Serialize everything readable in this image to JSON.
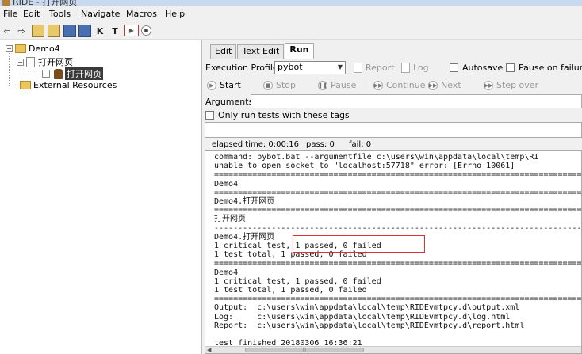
{
  "window": {
    "title": "RIDE - 打开网页"
  },
  "menu": [
    "File",
    "Edit",
    "Tools",
    "Navigate",
    "Macros",
    "Help"
  ],
  "toolbar": {
    "icons": [
      "back-arrow-icon",
      "forward-arrow-icon",
      "open-folder-icon",
      "open-directory-icon",
      "save-icon",
      "save-all-icon",
      "keyword-search-icon",
      "test-search-icon",
      "run-icon",
      "stop-icon"
    ],
    "k_label": "K",
    "t_label": "T"
  },
  "tree": {
    "root": "Demo4",
    "suite": "打开网页",
    "test": "打开网页",
    "external": "External Resources"
  },
  "tabs": [
    "Edit",
    "Text Edit",
    "Run"
  ],
  "active_tab": "Run",
  "run": {
    "profile_label": "Execution Profile:",
    "profile_value": "pybot",
    "report_label": "Report",
    "log_label": "Log",
    "autosave_label": "Autosave",
    "pause_label": "Pause on failure",
    "start_label": "Start",
    "stop_label": "Stop",
    "pausebtn_label": "Pause",
    "continue_label": "Continue",
    "next_label": "Next",
    "stepover_label": "Step over",
    "arguments_label": "Arguments:",
    "only_tags_label": "Only run tests with these tags"
  },
  "status": {
    "elapsed": "elapsed time: 0:00:16",
    "pass": "pass: 0",
    "fail": "fail: 0"
  },
  "output_lines": [
    "command: pybot.bat --argumentfile c:\\users\\win\\appdata\\local\\temp\\RI",
    "unable to open socket to \"localhost:57718\" error: [Errno 10061]",
    "==============================================================================",
    "Demo4",
    "==============================================================================",
    "Demo4.打开网页",
    "==============================================================================",
    "打开网页",
    "------------------------------------------------------------------------------",
    "Demo4.打开网页",
    "1 critical test, 1 passed, 0 failed",
    "1 test total, 1 passed, 0 failed",
    "==============================================================================",
    "Demo4",
    "1 critical test, 1 passed, 0 failed",
    "1 test total, 1 passed, 0 failed",
    "==============================================================================",
    "Output:  c:\\users\\win\\appdata\\local\\temp\\RIDEvmtpcy.d\\output.xml",
    "Log:     c:\\users\\win\\appdata\\local\\temp\\RIDEvmtpcy.d\\log.html",
    "Report:  c:\\users\\win\\appdata\\local\\temp\\RIDEvmtpcy.d\\report.html",
    "",
    "test finished 20180306 16:36:21"
  ]
}
